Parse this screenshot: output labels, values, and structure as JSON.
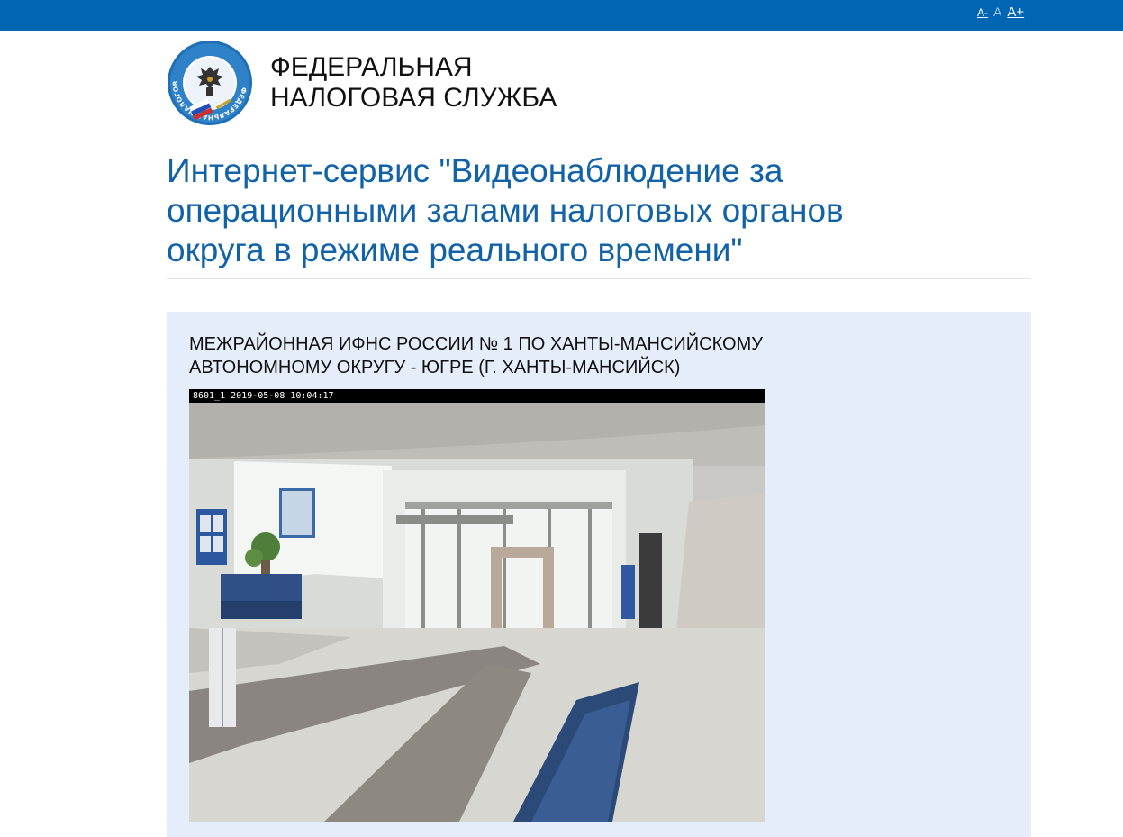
{
  "topbar": {
    "font_small": "A-",
    "font_normal": "A",
    "font_large": "A+"
  },
  "header": {
    "org_line1": "ФЕДЕРАЛЬНАЯ",
    "org_line2": "НАЛОГОВАЯ СЛУЖБА",
    "logo_ring_text": "ФЕДЕРАЛЬНАЯ НАЛОГОВАЯ СЛУЖБА"
  },
  "service": {
    "title_line1": "Интернет-сервис \"Видеонаблюдение за",
    "title_line2": "операционными залами налоговых органов",
    "title_line3": "округа в режиме реального времени\""
  },
  "camera": {
    "office_line1": "МЕЖРАЙОННАЯ ИФНС РОССИИ № 1 ПО ХАНТЫ-МАНСИЙСКОМУ",
    "office_line2": "АВТОНОМНОМУ ОКРУГУ - ЮГРЕ (Г. ХАНТЫ-МАНСИЙСК)",
    "osd_text": "8601_1 2019-05-08 10:04:17"
  },
  "colors": {
    "topbar": "#0066b3",
    "title": "#1262a8",
    "panel": "#e4edf9"
  }
}
